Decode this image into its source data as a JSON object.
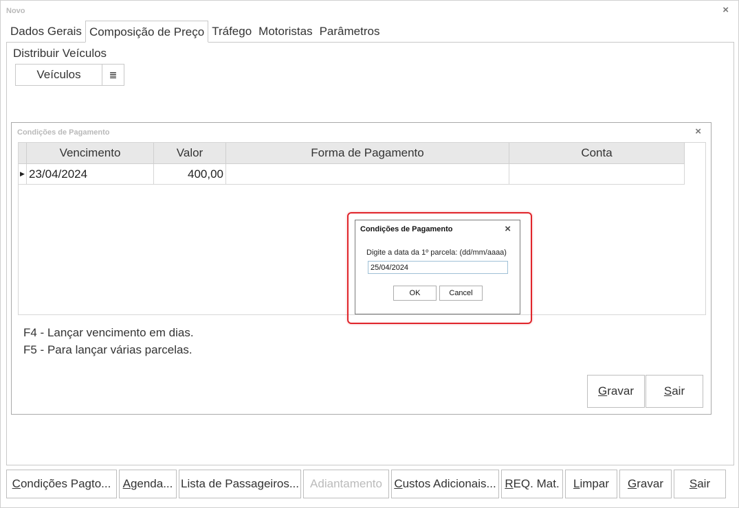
{
  "window": {
    "title": "Novo",
    "close_glyph": "×"
  },
  "tabs": [
    {
      "label": "Dados Gerais"
    },
    {
      "label": "Composição de Preço"
    },
    {
      "label": "Tráfego"
    },
    {
      "label": "Motoristas"
    },
    {
      "label": "Parâmetros"
    }
  ],
  "active_tab": "Composição de Preço",
  "distribute": {
    "group_label": "Distribuir Veículos",
    "vehicles_button": "Veículos",
    "list_icon": "list-icon",
    "list_glyph": "≣"
  },
  "payment_window": {
    "title": "Condições de Pagamento",
    "close_glyph": "×",
    "columns": [
      "Vencimento",
      "Valor",
      "Forma de Pagamento",
      "Conta"
    ],
    "rows": [
      {
        "indicator": "▶",
        "vencimento": "23/04/2024",
        "valor": "400,00",
        "forma": "",
        "conta": ""
      }
    ],
    "hints": [
      "F4 - Lançar vencimento em dias.",
      "F5 - Para lançar várias parcelas."
    ],
    "save_button": {
      "mnemonic": "G",
      "rest": "ravar"
    },
    "exit_button": {
      "mnemonic": "S",
      "rest": "air"
    }
  },
  "dialog": {
    "title": "Condições de Pagamento",
    "close_glyph": "×",
    "prompt": "Digite a data da 1º parcela: (dd/mm/aaaa)",
    "input_value": "25/04/2024",
    "ok_label": "OK",
    "cancel_label": "Cancel",
    "highlight_color": "#e0242a"
  },
  "bottom_toolbar": [
    {
      "mnemonic": "C",
      "rest": "ondições Pagto...",
      "disabled": false
    },
    {
      "mnemonic": "A",
      "rest": "genda...",
      "disabled": false
    },
    {
      "mnemonic": "",
      "rest": "Lista de Passageiros...",
      "disabled": false
    },
    {
      "mnemonic": "",
      "rest": "Adiantamento",
      "disabled": true
    },
    {
      "mnemonic": "C",
      "rest": "ustos Adicionais...",
      "disabled": false
    },
    {
      "mnemonic": "R",
      "rest": "EQ. Mat.",
      "disabled": false
    },
    {
      "mnemonic": "L",
      "rest": "impar",
      "disabled": false
    },
    {
      "mnemonic": "G",
      "rest": "ravar",
      "disabled": false
    },
    {
      "mnemonic": "S",
      "rest": "air",
      "disabled": false
    }
  ]
}
